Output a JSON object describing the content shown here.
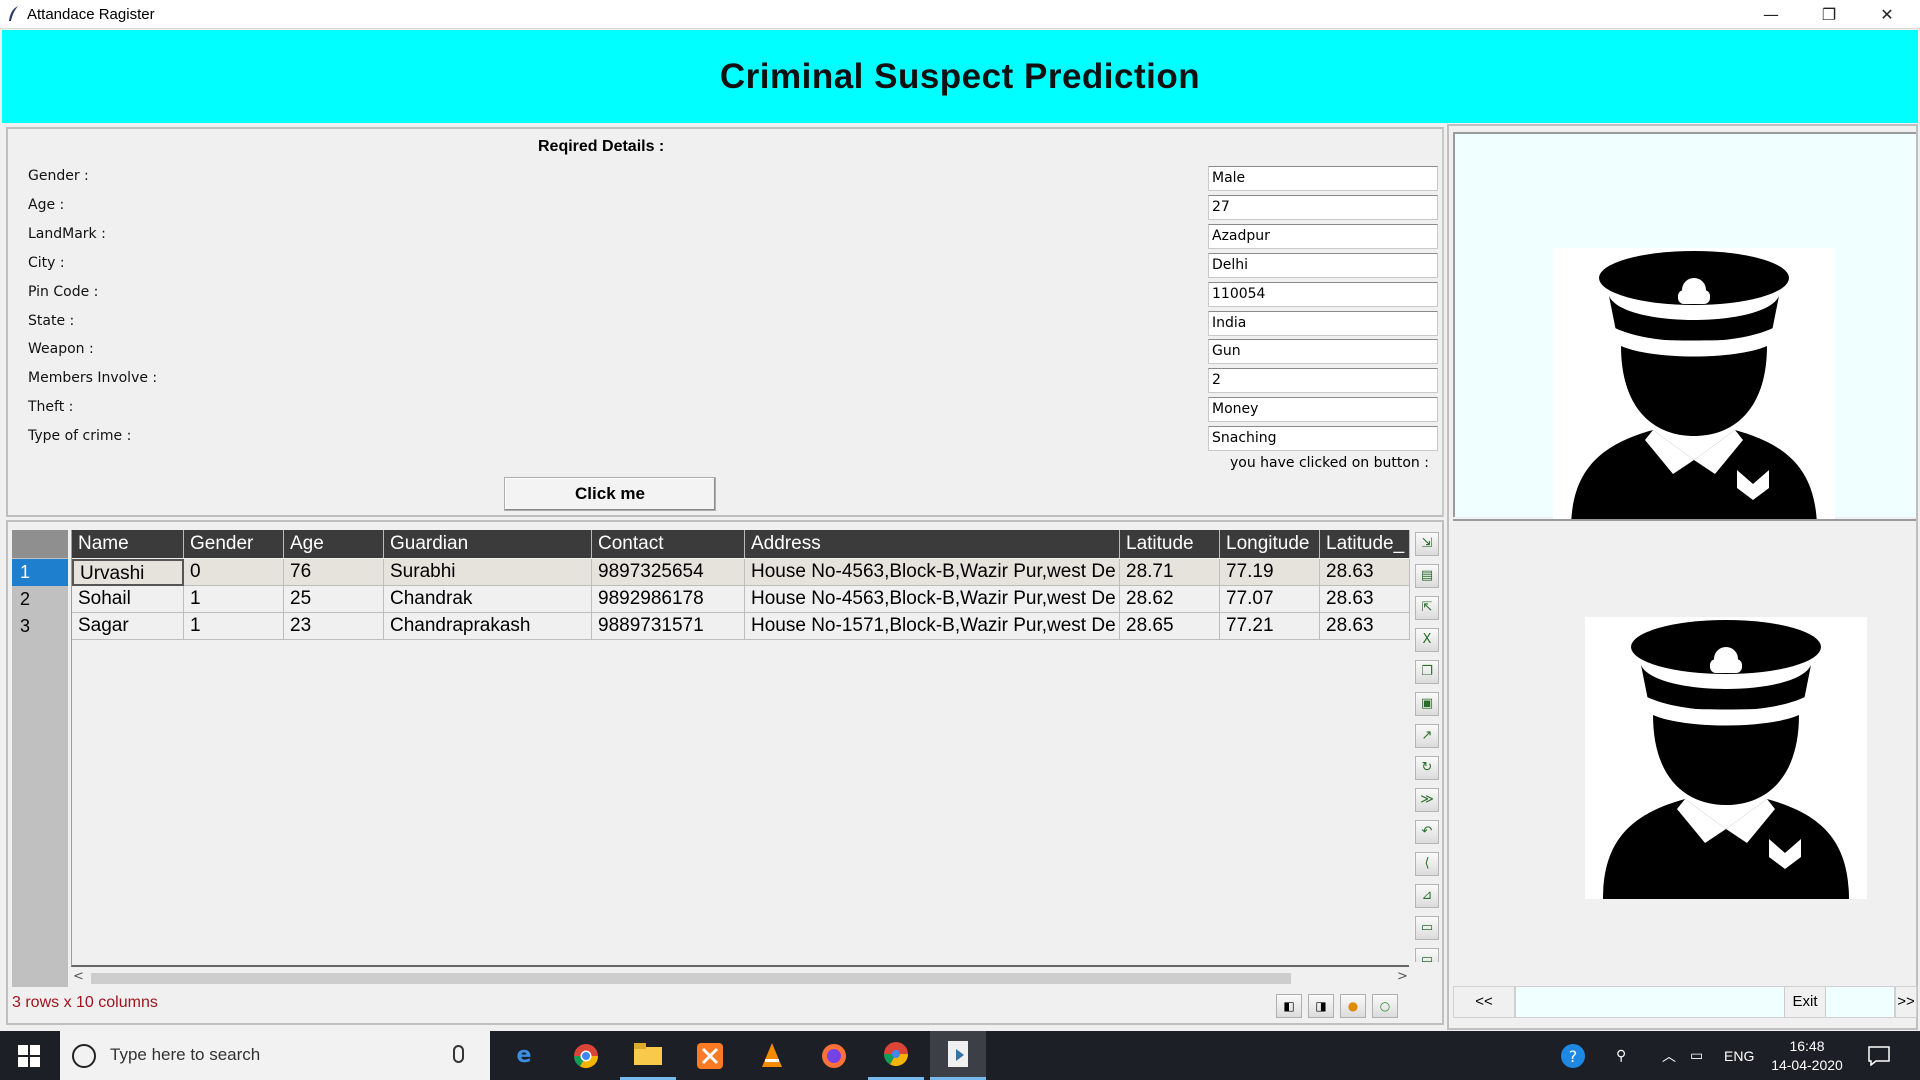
{
  "window": {
    "title": "Attandace Ragister",
    "minimize": "—",
    "restore": "❐",
    "close": "✕"
  },
  "header": {
    "title": "Criminal Suspect Prediction",
    "bg_color": "#00ffff"
  },
  "form": {
    "heading": "Reqired Details :",
    "fields": [
      {
        "label": "Gender :",
        "value": "Male"
      },
      {
        "label": "Age :",
        "value": "27"
      },
      {
        "label": "LandMark :",
        "value": "Azadpur"
      },
      {
        "label": "City :",
        "value": "Delhi"
      },
      {
        "label": "Pin Code :",
        "value": "110054"
      },
      {
        "label": "State :",
        "value": "India"
      },
      {
        "label": "Weapon :",
        "value": "Gun"
      },
      {
        "label": "Members Involve :",
        "value": "2"
      },
      {
        "label": "Theft :",
        "value": "Money"
      },
      {
        "label": "Type of crime :",
        "value": "Snaching"
      }
    ],
    "status": "you have clicked on button :",
    "button_label": "Click me"
  },
  "table": {
    "columns": [
      "Name",
      "Gender",
      "Age",
      "Guardian",
      "Contact",
      "Address",
      "Latitude",
      "Longitude",
      "Latitude_"
    ],
    "row_numbers": [
      "1",
      "2",
      "3"
    ],
    "rows": [
      [
        "Urvashi",
        "0",
        "76",
        "Surabhi",
        "9897325654",
        "House No-4563,Block-B,Wazir Pur,west De",
        "28.71",
        "77.19",
        "28.63"
      ],
      [
        "Sohail",
        "1",
        "25",
        "Chandrak",
        "9892986178",
        "House No-4563,Block-B,Wazir Pur,west De",
        "28.62",
        "77.07",
        "28.63"
      ],
      [
        "Sagar",
        "1",
        "23",
        "Chandraprakash",
        "9889731571",
        "House No-1571,Block-B,Wazir Pur,west De",
        "28.65",
        "77.21",
        "28.63"
      ]
    ],
    "summary": "3 rows x 10 columns",
    "selected_row_color": "#1e7fcf",
    "summary_color": "#a0141e"
  },
  "nav": {
    "prev": "<<",
    "exit": "Exit",
    "next": ">>"
  },
  "taskbar": {
    "search_placeholder": "Type here to search",
    "language": "ENG",
    "time": "16:48",
    "date": "14-04-2020"
  }
}
